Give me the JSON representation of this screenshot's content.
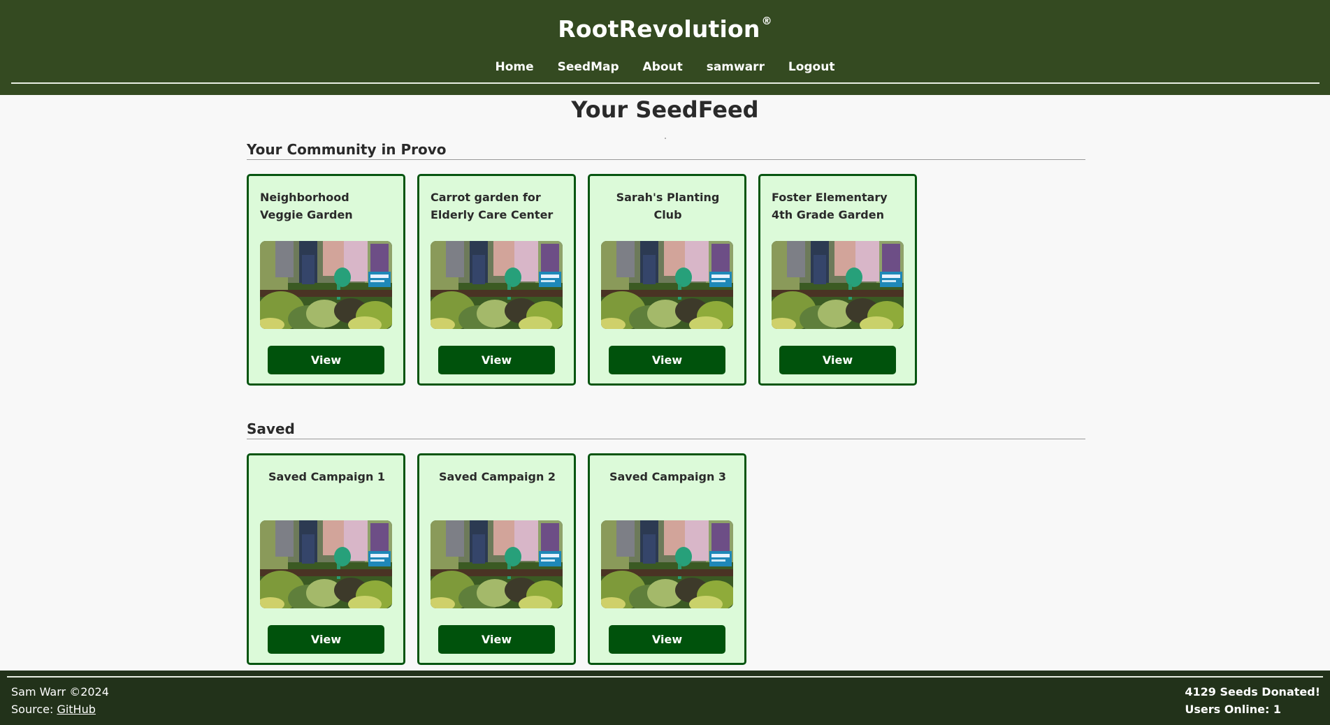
{
  "header": {
    "brand": "RootRevolution",
    "brand_mark": "®",
    "nav": [
      "Home",
      "SeedMap",
      "About",
      "samwarr",
      "Logout"
    ]
  },
  "main": {
    "title": "Your SeedFeed",
    "community": {
      "heading": "Your Community in Provo",
      "cards": [
        {
          "title": "Neighborhood Veggie Garden",
          "button": "View"
        },
        {
          "title": "Carrot garden for Elderly Care Center",
          "button": "View"
        },
        {
          "title": "Sarah's Planting Club",
          "button": "View"
        },
        {
          "title": "Foster Elementary 4th Grade Garden",
          "button": "View"
        }
      ]
    },
    "saved": {
      "heading": "Saved",
      "cards": [
        {
          "title": "Saved Campaign 1",
          "button": "View"
        },
        {
          "title": "Saved Campaign 2",
          "button": "View"
        },
        {
          "title": "Saved Campaign 3",
          "button": "View"
        }
      ]
    }
  },
  "footer": {
    "copyright": "Sam Warr ©2024",
    "source_prefix": "Source: ",
    "source_link": "GitHub",
    "seeds": "4129 Seeds Donated!",
    "users": "Users Online: 1"
  },
  "colors": {
    "header_bg": "#344a21",
    "footer_bg": "#22321a",
    "card_bg": "#dcfad9",
    "card_border": "#075511",
    "button_bg": "#00520c"
  }
}
